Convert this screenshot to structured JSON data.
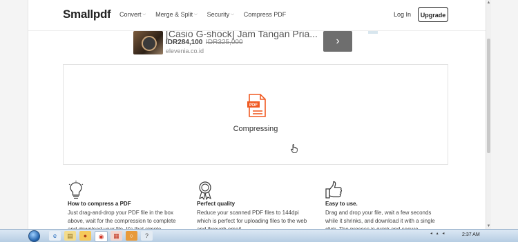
{
  "header": {
    "logo": "Smallpdf",
    "nav": [
      "Convert",
      "Merge & Split",
      "Security",
      "Compress PDF"
    ],
    "login": "Log In",
    "upgrade": "Upgrade"
  },
  "ad": {
    "title": "[Casio G-shock] Jam Tangan Pria...",
    "price": "IDR284,100",
    "old_price": "IDR325,000",
    "domain": "elevenia.co.id"
  },
  "dropzone": {
    "icon_text": "PDF",
    "status": "Compressing"
  },
  "features": [
    {
      "icon": "lightbulb-icon",
      "title": "How to compress a PDF",
      "lines": [
        "Just drag-and-drop your PDF file in the box",
        "above, wait for the compression to complete",
        "and download your file. It's that simple."
      ]
    },
    {
      "icon": "award-ribbon-icon",
      "title": "Perfect quality",
      "lines": [
        "Reduce your scanned PDF files to 144dpi",
        "which is perfect for uploading files to the web",
        "and through email."
      ]
    },
    {
      "icon": "thumbs-up-icon",
      "title": "Easy to use.",
      "lines": [
        "Drag and drop your file, wait a few seconds",
        "while it shrinks, and download it with a single",
        "click. The process is quick and secure."
      ]
    }
  ],
  "taskbar": {
    "clock": "2:37 AM",
    "tray": "◂ ▴ ◂"
  },
  "colors": {
    "accent": "#e8622c",
    "pdf_orange": "#f05a22"
  }
}
